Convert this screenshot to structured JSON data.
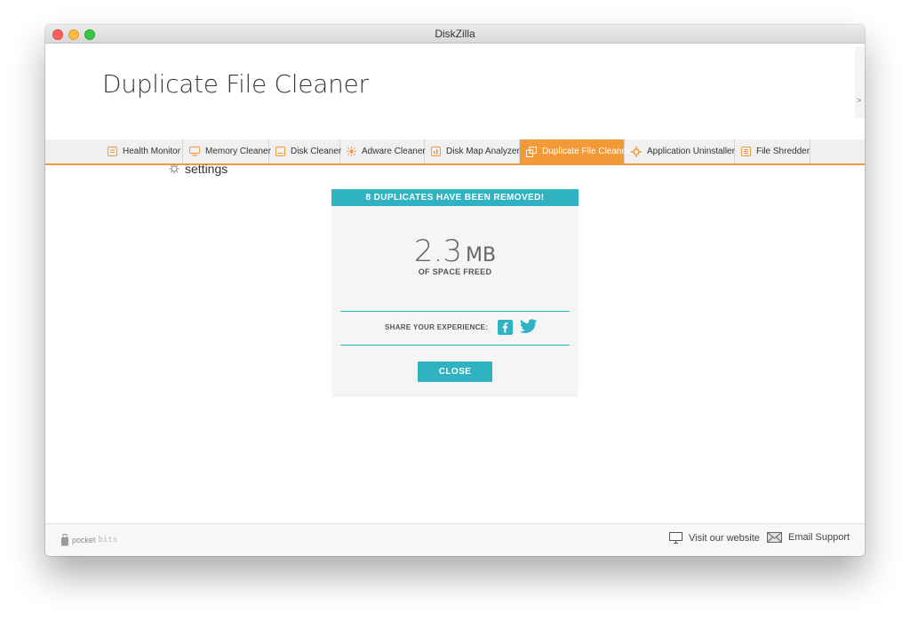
{
  "window": {
    "title": "DiskZilla"
  },
  "header": {
    "title": "Duplicate File Cleaner",
    "scroll_chevron": ">"
  },
  "tabs": [
    {
      "label": "Health Monitor",
      "icon": "health-monitor-icon",
      "active": false
    },
    {
      "label": "Memory Cleaner",
      "icon": "memory-cleaner-icon",
      "active": false
    },
    {
      "label": "Disk Cleaner",
      "icon": "disk-cleaner-icon",
      "active": false
    },
    {
      "label": "Adware Cleaner",
      "icon": "adware-cleaner-icon",
      "active": false
    },
    {
      "label": "Disk Map Analyzer",
      "icon": "disk-map-analyzer-icon",
      "active": false
    },
    {
      "label": "Duplicate File Cleaner",
      "icon": "duplicate-file-cleaner-icon",
      "active": true
    },
    {
      "label": "Application Uninstaller",
      "icon": "application-uninstaller-icon",
      "active": false
    },
    {
      "label": "File Shredder",
      "icon": "file-shredder-icon",
      "active": false
    }
  ],
  "settings": {
    "label": "settings"
  },
  "dialog": {
    "heading": "8 DUPLICATES HAVE BEEN REMOVED!",
    "size_value": "2.3",
    "size_unit": "MB",
    "freed_label": "OF SPACE FREED",
    "share_label": "SHARE YOUR EXPERIENCE:",
    "close_label": "CLOSE"
  },
  "footer": {
    "brand_prefix": "pocket",
    "brand_suffix": "bits",
    "website_label": "Visit our website",
    "support_label": "Email Support"
  },
  "colors": {
    "accent_orange": "#f29a38",
    "accent_teal": "#2fb3c3",
    "text_dark": "#3a3a3a"
  }
}
